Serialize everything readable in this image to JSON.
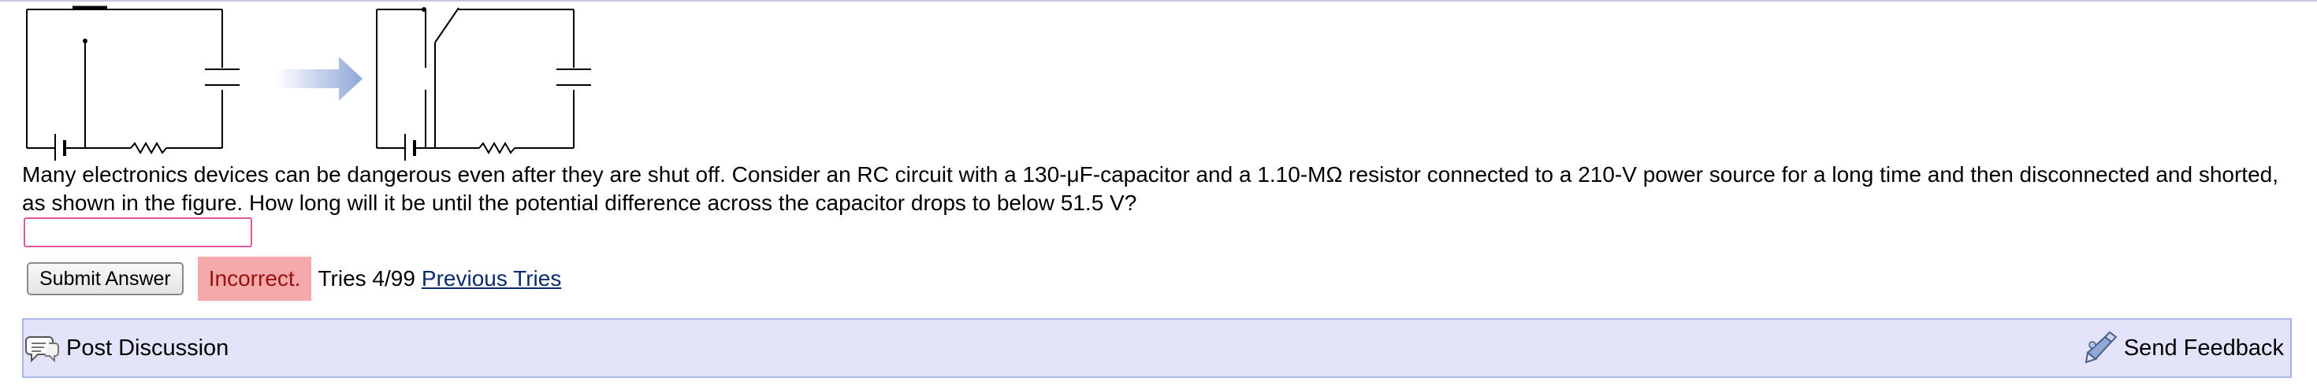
{
  "question": {
    "text": "Many electronics devices can be dangerous even after they are shut off. Consider an RC circuit with a 130-μF-capacitor and a 1.10-MΩ resistor connected to a 210-V power source for a long time and then disconnected and shorted, as shown in the figure. How long will it be until the potential difference across the capacitor drops to below 51.5 V?"
  },
  "answer": {
    "value": "",
    "placeholder": ""
  },
  "submit": {
    "label": "Submit Answer"
  },
  "feedback": {
    "status": "Incorrect.",
    "tries": "Tries 4/99",
    "previous_tries_link": "Previous Tries",
    "status_color": "#f4aaaa"
  },
  "footer": {
    "post_discussion": "Post Discussion",
    "send_feedback": "Send Feedback",
    "bar_color": "#e3e3fa"
  },
  "icons": {
    "discussion": "speech-bubble-icon",
    "feedback": "feedback-icon",
    "arrow": "arrow-right-icon"
  }
}
